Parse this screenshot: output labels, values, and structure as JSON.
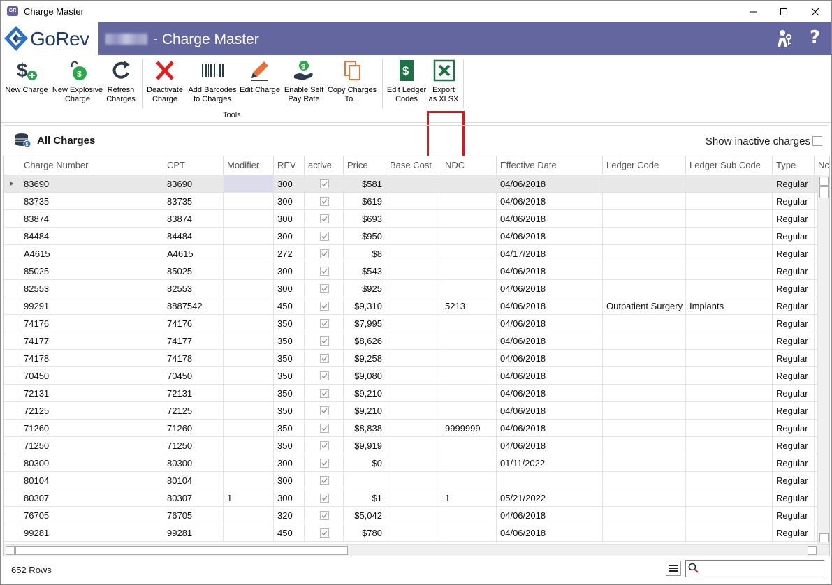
{
  "window": {
    "title": "Charge Master",
    "app_icon_text": "GR"
  },
  "header": {
    "logo_text": "GoRev",
    "title": "- Charge Master"
  },
  "ribbon": {
    "buttons": [
      {
        "label": "New Charge",
        "icon": "dollar-plus-icon"
      },
      {
        "label": "New Explosive\nCharge",
        "icon": "bomb-icon"
      },
      {
        "label": "Refresh\nCharges",
        "icon": "refresh-icon"
      },
      {
        "label": "Deactivate\nCharge",
        "icon": "x-icon"
      },
      {
        "label": "Add Barcodes\nto Charges",
        "icon": "barcode-icon"
      },
      {
        "label": "Edit Charge",
        "icon": "pencil-icon"
      },
      {
        "label": "Enable Self\nPay Rate",
        "icon": "hand-coins-icon"
      },
      {
        "label": "Copy Charges\nTo...",
        "icon": "copy-icon"
      },
      {
        "label": "Edit Ledger\nCodes",
        "icon": "ledger-icon"
      },
      {
        "label": "Export\nas XLSX",
        "icon": "excel-icon"
      }
    ],
    "group_label": "Tools"
  },
  "panel": {
    "title": "All Charges",
    "show_inactive_label": "Show inactive charges",
    "show_inactive_checked": false
  },
  "grid": {
    "columns": [
      "Charge Number",
      "CPT",
      "Modifier",
      "REV",
      "active",
      "Price",
      "Base Cost",
      "NDC",
      "Effective Date",
      "Ledger Code",
      "Ledger Sub Code",
      "Type",
      "Nc"
    ],
    "rows": [
      [
        "83690",
        "83690",
        "",
        "300",
        true,
        "$581",
        "",
        "",
        "04/06/2018",
        "",
        "",
        "Regular"
      ],
      [
        "83735",
        "83735",
        "",
        "300",
        true,
        "$619",
        "",
        "",
        "04/06/2018",
        "",
        "",
        "Regular"
      ],
      [
        "83874",
        "83874",
        "",
        "300",
        true,
        "$693",
        "",
        "",
        "04/06/2018",
        "",
        "",
        "Regular"
      ],
      [
        "84484",
        "84484",
        "",
        "300",
        true,
        "$950",
        "",
        "",
        "04/06/2018",
        "",
        "",
        "Regular"
      ],
      [
        "A4615",
        "A4615",
        "",
        "272",
        true,
        "$8",
        "",
        "",
        "04/17/2018",
        "",
        "",
        "Regular"
      ],
      [
        "85025",
        "85025",
        "",
        "300",
        true,
        "$543",
        "",
        "",
        "04/06/2018",
        "",
        "",
        "Regular"
      ],
      [
        "82553",
        "82553",
        "",
        "300",
        true,
        "$925",
        "",
        "",
        "04/06/2018",
        "",
        "",
        "Regular"
      ],
      [
        "99291",
        "8887542",
        "",
        "450",
        true,
        "$9,310",
        "",
        "5213",
        "04/06/2018",
        "Outpatient Surgery",
        "Implants",
        "Regular"
      ],
      [
        "74176",
        "74176",
        "",
        "350",
        true,
        "$7,995",
        "",
        "",
        "04/06/2018",
        "",
        "",
        "Regular"
      ],
      [
        "74177",
        "74177",
        "",
        "350",
        true,
        "$8,626",
        "",
        "",
        "04/06/2018",
        "",
        "",
        "Regular"
      ],
      [
        "74178",
        "74178",
        "",
        "350",
        true,
        "$9,258",
        "",
        "",
        "04/06/2018",
        "",
        "",
        "Regular"
      ],
      [
        "70450",
        "70450",
        "",
        "350",
        true,
        "$9,080",
        "",
        "",
        "04/06/2018",
        "",
        "",
        "Regular"
      ],
      [
        "72131",
        "72131",
        "",
        "350",
        true,
        "$9,210",
        "",
        "",
        "04/06/2018",
        "",
        "",
        "Regular"
      ],
      [
        "72125",
        "72125",
        "",
        "350",
        true,
        "$9,210",
        "",
        "",
        "04/06/2018",
        "",
        "",
        "Regular"
      ],
      [
        "71260",
        "71260",
        "",
        "350",
        true,
        "$8,838",
        "",
        "9999999",
        "04/06/2018",
        "",
        "",
        "Regular"
      ],
      [
        "71250",
        "71250",
        "",
        "350",
        true,
        "$9,919",
        "",
        "",
        "04/06/2018",
        "",
        "",
        "Regular"
      ],
      [
        "80300",
        "80300",
        "",
        "300",
        true,
        "$0",
        "",
        "",
        "01/11/2022",
        "",
        "",
        "Regular"
      ],
      [
        "80104",
        "80104",
        "",
        "300",
        true,
        "",
        "",
        "",
        "",
        "",
        "",
        "Regular"
      ],
      [
        "80307",
        "80307",
        "1",
        "300",
        true,
        "$1",
        "",
        "1",
        "05/21/2022",
        "",
        "",
        "Regular"
      ],
      [
        "76705",
        "76705",
        "",
        "320",
        true,
        "$5,042",
        "",
        "",
        "04/06/2018",
        "",
        "",
        "Regular"
      ],
      [
        "99281",
        "99281",
        "",
        "450",
        true,
        "$780",
        "",
        "",
        "04/06/2018",
        "",
        "",
        "Regular"
      ]
    ],
    "selected_row": 0
  },
  "footer": {
    "row_count": "652 Rows",
    "search_placeholder": ""
  },
  "colors": {
    "header_bg": "#6466a0",
    "highlight": "#e5121a",
    "excel_green": "#1e7145"
  }
}
